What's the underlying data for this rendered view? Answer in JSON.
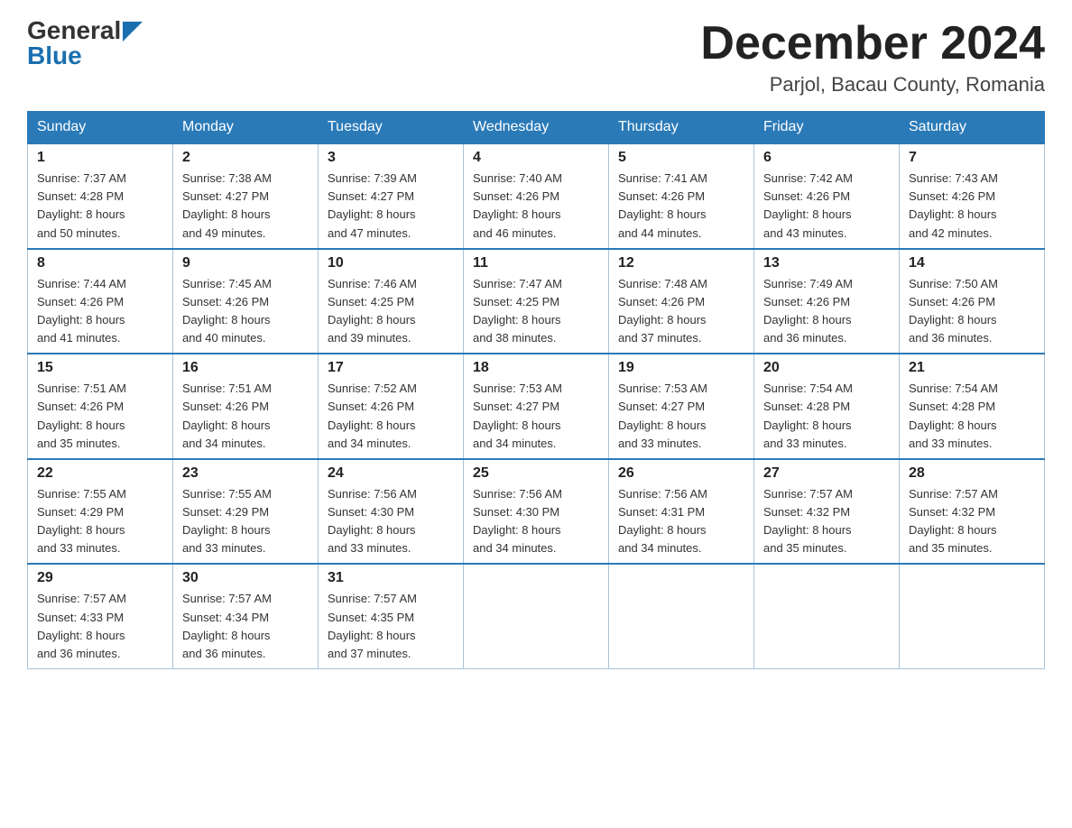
{
  "logo": {
    "text1": "General",
    "text2": "Blue"
  },
  "title": {
    "month": "December 2024",
    "location": "Parjol, Bacau County, Romania"
  },
  "days_of_week": [
    "Sunday",
    "Monday",
    "Tuesday",
    "Wednesday",
    "Thursday",
    "Friday",
    "Saturday"
  ],
  "weeks": [
    [
      {
        "day": "1",
        "sunrise": "7:37 AM",
        "sunset": "4:28 PM",
        "daylight": "8 hours and 50 minutes."
      },
      {
        "day": "2",
        "sunrise": "7:38 AM",
        "sunset": "4:27 PM",
        "daylight": "8 hours and 49 minutes."
      },
      {
        "day": "3",
        "sunrise": "7:39 AM",
        "sunset": "4:27 PM",
        "daylight": "8 hours and 47 minutes."
      },
      {
        "day": "4",
        "sunrise": "7:40 AM",
        "sunset": "4:26 PM",
        "daylight": "8 hours and 46 minutes."
      },
      {
        "day": "5",
        "sunrise": "7:41 AM",
        "sunset": "4:26 PM",
        "daylight": "8 hours and 44 minutes."
      },
      {
        "day": "6",
        "sunrise": "7:42 AM",
        "sunset": "4:26 PM",
        "daylight": "8 hours and 43 minutes."
      },
      {
        "day": "7",
        "sunrise": "7:43 AM",
        "sunset": "4:26 PM",
        "daylight": "8 hours and 42 minutes."
      }
    ],
    [
      {
        "day": "8",
        "sunrise": "7:44 AM",
        "sunset": "4:26 PM",
        "daylight": "8 hours and 41 minutes."
      },
      {
        "day": "9",
        "sunrise": "7:45 AM",
        "sunset": "4:26 PM",
        "daylight": "8 hours and 40 minutes."
      },
      {
        "day": "10",
        "sunrise": "7:46 AM",
        "sunset": "4:25 PM",
        "daylight": "8 hours and 39 minutes."
      },
      {
        "day": "11",
        "sunrise": "7:47 AM",
        "sunset": "4:25 PM",
        "daylight": "8 hours and 38 minutes."
      },
      {
        "day": "12",
        "sunrise": "7:48 AM",
        "sunset": "4:26 PM",
        "daylight": "8 hours and 37 minutes."
      },
      {
        "day": "13",
        "sunrise": "7:49 AM",
        "sunset": "4:26 PM",
        "daylight": "8 hours and 36 minutes."
      },
      {
        "day": "14",
        "sunrise": "7:50 AM",
        "sunset": "4:26 PM",
        "daylight": "8 hours and 36 minutes."
      }
    ],
    [
      {
        "day": "15",
        "sunrise": "7:51 AM",
        "sunset": "4:26 PM",
        "daylight": "8 hours and 35 minutes."
      },
      {
        "day": "16",
        "sunrise": "7:51 AM",
        "sunset": "4:26 PM",
        "daylight": "8 hours and 34 minutes."
      },
      {
        "day": "17",
        "sunrise": "7:52 AM",
        "sunset": "4:26 PM",
        "daylight": "8 hours and 34 minutes."
      },
      {
        "day": "18",
        "sunrise": "7:53 AM",
        "sunset": "4:27 PM",
        "daylight": "8 hours and 34 minutes."
      },
      {
        "day": "19",
        "sunrise": "7:53 AM",
        "sunset": "4:27 PM",
        "daylight": "8 hours and 33 minutes."
      },
      {
        "day": "20",
        "sunrise": "7:54 AM",
        "sunset": "4:28 PM",
        "daylight": "8 hours and 33 minutes."
      },
      {
        "day": "21",
        "sunrise": "7:54 AM",
        "sunset": "4:28 PM",
        "daylight": "8 hours and 33 minutes."
      }
    ],
    [
      {
        "day": "22",
        "sunrise": "7:55 AM",
        "sunset": "4:29 PM",
        "daylight": "8 hours and 33 minutes."
      },
      {
        "day": "23",
        "sunrise": "7:55 AM",
        "sunset": "4:29 PM",
        "daylight": "8 hours and 33 minutes."
      },
      {
        "day": "24",
        "sunrise": "7:56 AM",
        "sunset": "4:30 PM",
        "daylight": "8 hours and 33 minutes."
      },
      {
        "day": "25",
        "sunrise": "7:56 AM",
        "sunset": "4:30 PM",
        "daylight": "8 hours and 34 minutes."
      },
      {
        "day": "26",
        "sunrise": "7:56 AM",
        "sunset": "4:31 PM",
        "daylight": "8 hours and 34 minutes."
      },
      {
        "day": "27",
        "sunrise": "7:57 AM",
        "sunset": "4:32 PM",
        "daylight": "8 hours and 35 minutes."
      },
      {
        "day": "28",
        "sunrise": "7:57 AM",
        "sunset": "4:32 PM",
        "daylight": "8 hours and 35 minutes."
      }
    ],
    [
      {
        "day": "29",
        "sunrise": "7:57 AM",
        "sunset": "4:33 PM",
        "daylight": "8 hours and 36 minutes."
      },
      {
        "day": "30",
        "sunrise": "7:57 AM",
        "sunset": "4:34 PM",
        "daylight": "8 hours and 36 minutes."
      },
      {
        "day": "31",
        "sunrise": "7:57 AM",
        "sunset": "4:35 PM",
        "daylight": "8 hours and 37 minutes."
      },
      null,
      null,
      null,
      null
    ]
  ],
  "labels": {
    "sunrise": "Sunrise:",
    "sunset": "Sunset:",
    "daylight": "Daylight:"
  }
}
